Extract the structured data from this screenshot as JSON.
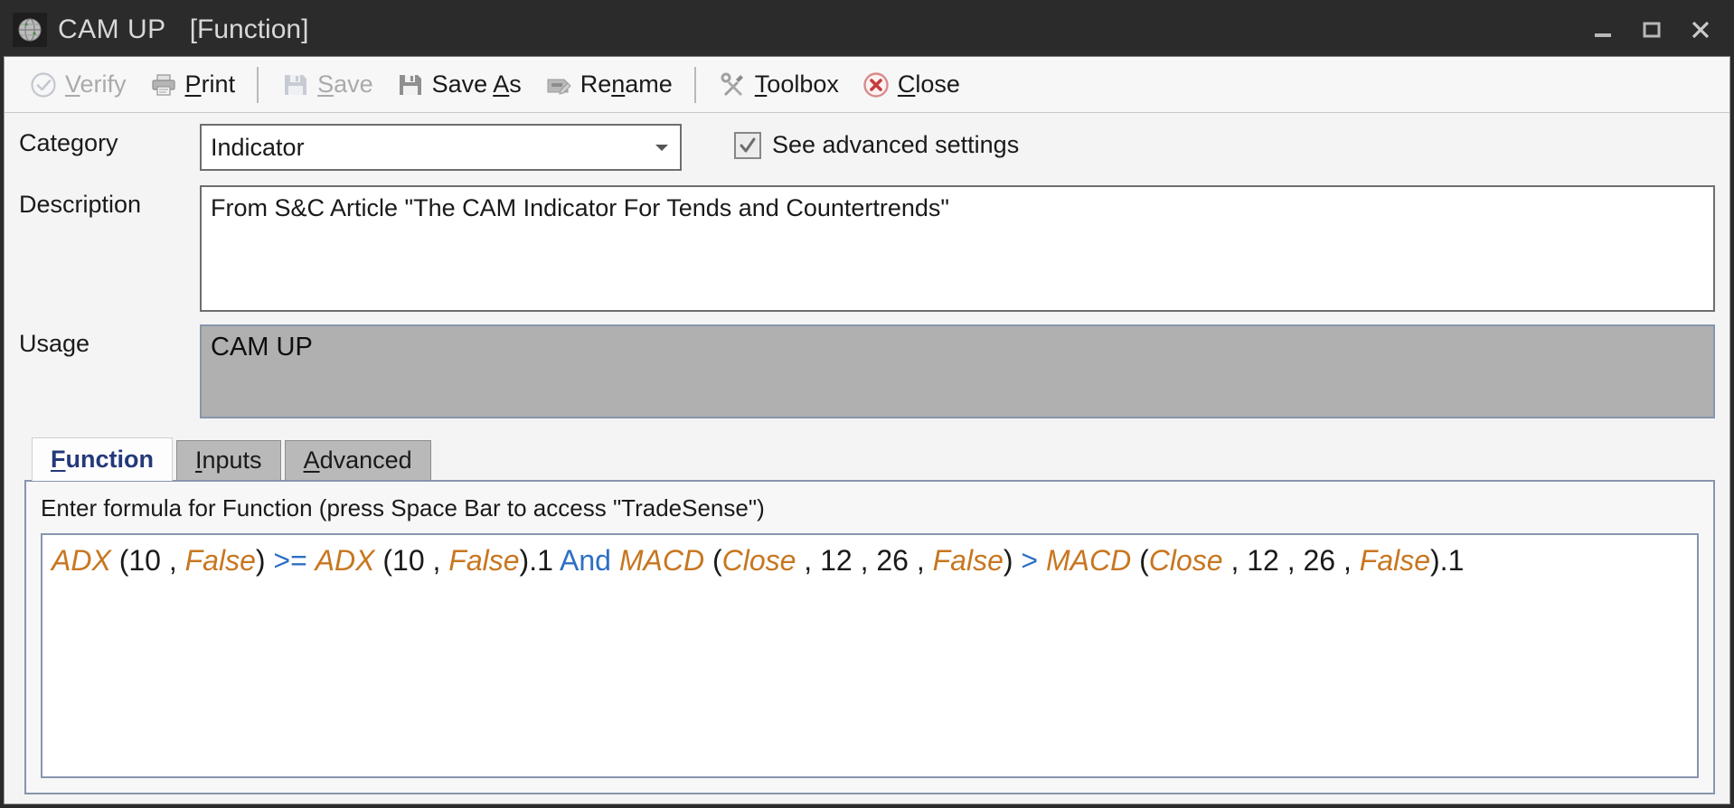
{
  "window": {
    "title": "CAM UP",
    "subtitle": "[Function]",
    "app_icon": "app-globe-icon",
    "controls": {
      "minimize": "minimize-icon",
      "maximize": "maximize-icon",
      "close": "close-icon"
    }
  },
  "toolbar": {
    "items": [
      {
        "id": "verify",
        "label": "Verify",
        "accel": "V",
        "icon": "check-circle-icon",
        "disabled": true
      },
      {
        "id": "print",
        "label": "Print",
        "accel": "P",
        "icon": "printer-icon",
        "disabled": false
      },
      {
        "id": "save",
        "label": "Save",
        "accel": "S",
        "icon": "floppy-icon",
        "disabled": true
      },
      {
        "id": "saveas",
        "label": "Save As",
        "accel": "A",
        "icon": "floppy-icon",
        "disabled": false
      },
      {
        "id": "rename",
        "label": "Rename",
        "accel": "n",
        "icon": "rename-icon",
        "disabled": false
      },
      {
        "id": "toolbox",
        "label": "Toolbox",
        "accel": "T",
        "icon": "tools-icon",
        "disabled": false
      },
      {
        "id": "close",
        "label": "Close",
        "accel": "C",
        "icon": "close-circle-icon",
        "disabled": false
      }
    ]
  },
  "form": {
    "category_label": "Category",
    "category_value": "Indicator",
    "category_options": [
      "Indicator"
    ],
    "advanced_checkbox_label": "See advanced settings",
    "advanced_checkbox_checked": true,
    "description_label": "Description",
    "description_value": "From S&C Article \"The CAM Indicator For Tends and Countertrends\"",
    "usage_label": "Usage",
    "usage_value": "CAM UP"
  },
  "tabs": {
    "items": [
      {
        "id": "function",
        "label": "Function",
        "accel": "F",
        "active": true
      },
      {
        "id": "inputs",
        "label": "Inputs",
        "accel": "I",
        "active": false
      },
      {
        "id": "advanced",
        "label": "Advanced",
        "accel": "A",
        "active": false
      }
    ],
    "panel_hint": "Enter formula for Function  (press Space Bar to access \"TradeSense\")",
    "formula_plain": "ADX (10 , False) >= ADX (10 , False).1 And MACD (Close , 12 , 26 , False) > MACD (Close , 12 , 26 , False).1",
    "formula_tokens": [
      {
        "t": "ADX",
        "k": "fn"
      },
      {
        "t": " (",
        "k": "punc"
      },
      {
        "t": "10",
        "k": "num"
      },
      {
        "t": " , ",
        "k": "punc"
      },
      {
        "t": "False",
        "k": "arg"
      },
      {
        "t": ")",
        "k": "punc"
      },
      {
        "t": " >= ",
        "k": "op"
      },
      {
        "t": "ADX",
        "k": "fn"
      },
      {
        "t": " (",
        "k": "punc"
      },
      {
        "t": "10",
        "k": "num"
      },
      {
        "t": " , ",
        "k": "punc"
      },
      {
        "t": "False",
        "k": "arg"
      },
      {
        "t": ").",
        "k": "punc"
      },
      {
        "t": "1",
        "k": "num"
      },
      {
        "t": " And ",
        "k": "kw"
      },
      {
        "t": "MACD",
        "k": "fn"
      },
      {
        "t": " (",
        "k": "punc"
      },
      {
        "t": "Close",
        "k": "arg"
      },
      {
        "t": " , ",
        "k": "punc"
      },
      {
        "t": "12",
        "k": "num"
      },
      {
        "t": " , ",
        "k": "punc"
      },
      {
        "t": "26",
        "k": "num"
      },
      {
        "t": " , ",
        "k": "punc"
      },
      {
        "t": "False",
        "k": "arg"
      },
      {
        "t": ")",
        "k": "punc"
      },
      {
        "t": " > ",
        "k": "op"
      },
      {
        "t": "MACD",
        "k": "fn"
      },
      {
        "t": " (",
        "k": "punc"
      },
      {
        "t": "Close",
        "k": "arg"
      },
      {
        "t": " , ",
        "k": "punc"
      },
      {
        "t": "12",
        "k": "num"
      },
      {
        "t": " , ",
        "k": "punc"
      },
      {
        "t": "26",
        "k": "num"
      },
      {
        "t": " , ",
        "k": "punc"
      },
      {
        "t": "False",
        "k": "arg"
      },
      {
        "t": ").",
        "k": "punc"
      },
      {
        "t": "1",
        "k": "num"
      }
    ]
  },
  "colors": {
    "titlebar_bg": "#2b2b2b",
    "titlebar_text": "#d8d8d8",
    "client_bg": "#f4f4f4",
    "toolbar_bg": "#f7f7f7",
    "disabled_text": "#a9aaac",
    "usage_bg": "#b0b0b0",
    "field_border": "#6e6e6e",
    "panel_border": "#8795ad",
    "formula_identifier": "#c8761f",
    "formula_operator": "#2d6fc4",
    "active_tab_text": "#23397a",
    "close_icon_red": "#cc5a5a"
  }
}
